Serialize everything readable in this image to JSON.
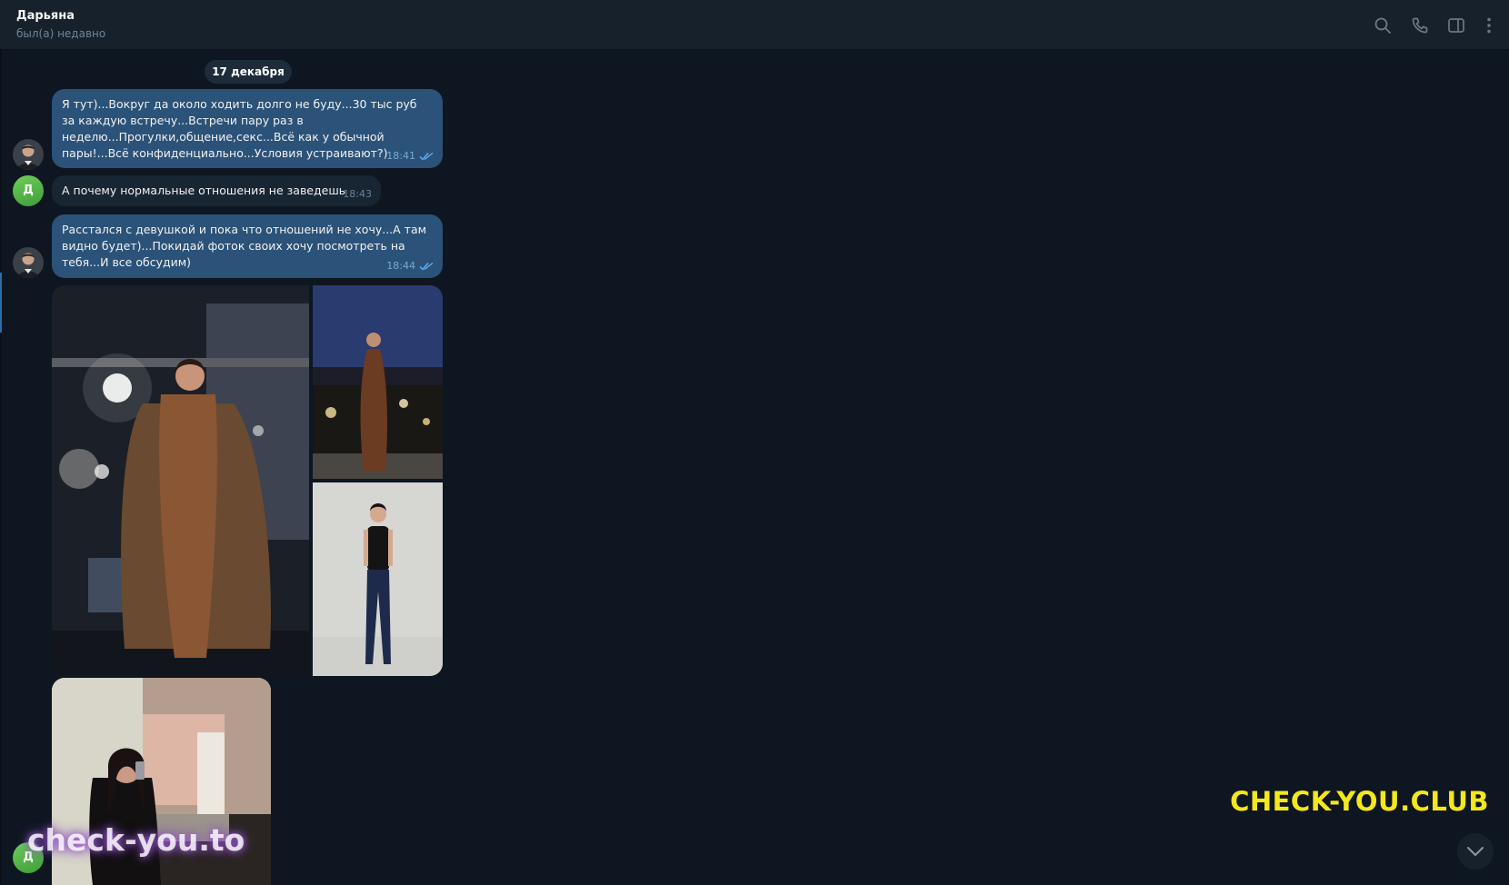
{
  "header": {
    "title": "Дарьяна",
    "status": "был(а) недавно",
    "icons": [
      "search-icon",
      "phone-icon",
      "side-panel-icon",
      "more-icon"
    ]
  },
  "date_separator": "17 декабря",
  "messages": [
    {
      "direction": "out",
      "text": "Я тут)...Вокруг да около ходить долго не буду...30 тыс руб за каждую встречу...Встречи пару раз в неделю...Прогулки,общение,секс...Всё как у обычной пары!...Всё конфиденциально...Условия устраивают?)",
      "time": "18:41",
      "read": true
    },
    {
      "direction": "in",
      "avatar_letter": "Д",
      "text": "А почему нормальные отношения не заведешь",
      "time": "18:43"
    },
    {
      "direction": "out",
      "text": "Расстался с девушкой и пока что отношений не хочу...А там видно будет)...Покидай фоток своих хочу посмотреть на тебя...И все обсудим)",
      "time": "18:44",
      "read": true
    }
  ],
  "album": {
    "photos": [
      "runway-photo-large",
      "runway-photo-small",
      "studio-photo"
    ]
  },
  "incoming_photo": {
    "avatar_letter": "Д",
    "photo": "mirror-selfie-photo"
  },
  "watermarks": {
    "brand": "CHECK-YOU.CLUB",
    "site": "check-you.to",
    "brand_color": "#f4e71c"
  },
  "colors": {
    "background": "#0e1621",
    "header": "#17212b",
    "outgoing_bubble": "#2b5278",
    "incoming_bubble": "#182533",
    "read_checks": "#5fb0f0"
  }
}
